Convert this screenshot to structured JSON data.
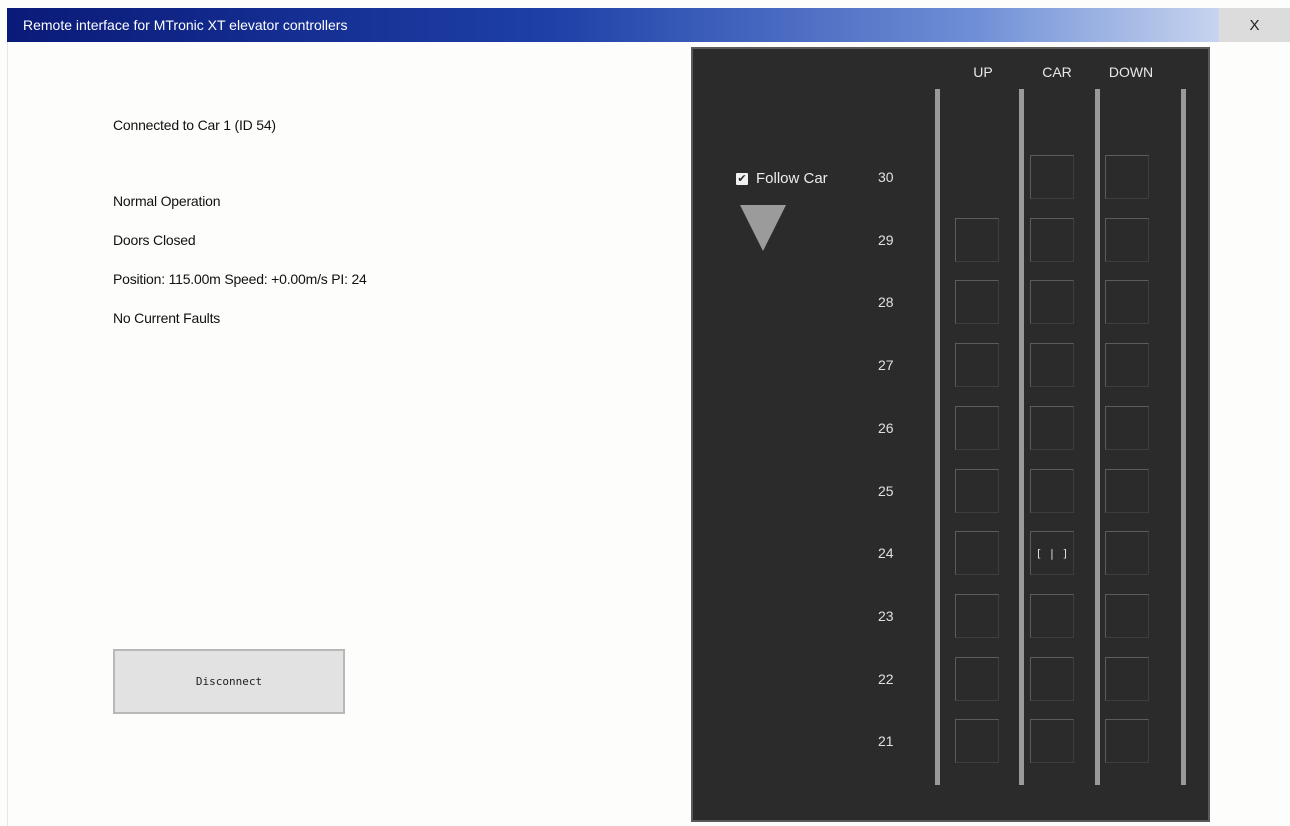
{
  "window": {
    "title": "Remote interface for MTronic XT elevator controllers",
    "close_label": "X"
  },
  "status": {
    "connection": "Connected to Car 1 (ID 54)",
    "mode": "Normal Operation",
    "doors": "Doors Closed",
    "position": "Position: 115.00m Speed: +0.00m/s PI: 24",
    "faults": "No Current Faults"
  },
  "actions": {
    "disconnect_label": "Disconnect"
  },
  "panel": {
    "headers": {
      "up": "UP",
      "car": "CAR",
      "down": "DOWN"
    },
    "follow_car": {
      "label": "Follow Car",
      "checked": true
    },
    "direction_indicator": "down-arrow-icon",
    "car_floor": "24",
    "car_marker": "[ | ]",
    "floors": [
      {
        "label": "30",
        "up_call": false,
        "car_call": true,
        "down_call": true
      },
      {
        "label": "29",
        "up_call": true,
        "car_call": true,
        "down_call": true
      },
      {
        "label": "28",
        "up_call": true,
        "car_call": true,
        "down_call": true
      },
      {
        "label": "27",
        "up_call": true,
        "car_call": true,
        "down_call": true
      },
      {
        "label": "26",
        "up_call": true,
        "car_call": true,
        "down_call": true
      },
      {
        "label": "25",
        "up_call": true,
        "car_call": true,
        "down_call": true
      },
      {
        "label": "24",
        "up_call": true,
        "car_call": true,
        "down_call": true
      },
      {
        "label": "23",
        "up_call": true,
        "car_call": true,
        "down_call": true
      },
      {
        "label": "22",
        "up_call": true,
        "car_call": true,
        "down_call": true
      },
      {
        "label": "21",
        "up_call": true,
        "car_call": true,
        "down_call": true
      }
    ]
  },
  "colors": {
    "panel_background": "#2b2b2b",
    "rail": "#9a9a9a",
    "title_gradient_start": "#0a1a78"
  }
}
